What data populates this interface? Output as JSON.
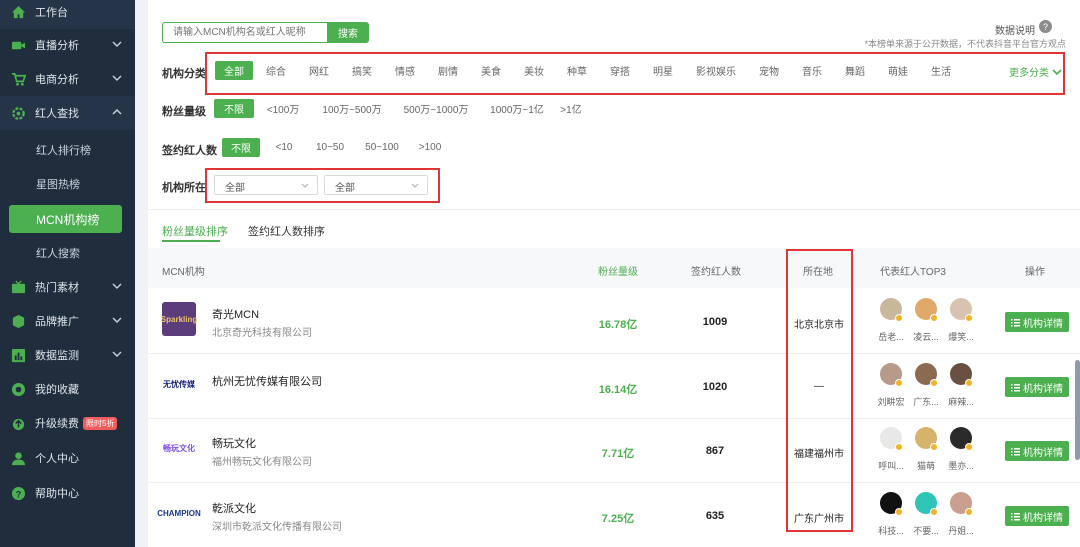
{
  "sidebar": {
    "items": [
      {
        "label": "工作台",
        "icon": "home-icon"
      },
      {
        "label": "直播分析",
        "icon": "video-icon"
      },
      {
        "label": "电商分析",
        "icon": "cart-icon"
      },
      {
        "label": "红人查找",
        "icon": "gear-icon"
      },
      {
        "label": "热门素材",
        "icon": "tv-icon"
      },
      {
        "label": "品牌推广",
        "icon": "cube-icon"
      },
      {
        "label": "数据监测",
        "icon": "bar-chart-icon"
      },
      {
        "label": "我的收藏",
        "icon": "star-icon"
      },
      {
        "label": "升级续费",
        "icon": "upgrade-icon",
        "badge": "限时5折"
      },
      {
        "label": "个人中心",
        "icon": "user-icon"
      },
      {
        "label": "帮助中心",
        "icon": "help-icon"
      }
    ],
    "sub_items": [
      "红人排行榜",
      "星图热榜",
      "MCN机构榜",
      "红人搜索"
    ]
  },
  "search": {
    "placeholder": "请输入MCN机构名或红人昵称",
    "button": "搜索"
  },
  "data_note": "数据说明",
  "disclaimer": "*本榜单来源于公开数据，不代表抖音平台官方观点",
  "filters": {
    "category_label": "机构分类",
    "categories": [
      "全部",
      "综合",
      "网红",
      "搞笑",
      "情感",
      "剧情",
      "美食",
      "美妆",
      "种草",
      "穿搭",
      "明星",
      "影视娱乐",
      "宠物",
      "音乐",
      "舞蹈",
      "萌娃",
      "生活"
    ],
    "more": "更多分类",
    "fans_label": "粉丝量级",
    "fans_options": [
      "不限",
      "<100万",
      "100万~500万",
      "500万~1000万",
      "1000万~1亿",
      ">1亿"
    ],
    "signed_label": "签约红人数",
    "signed_options": [
      "不限",
      "<10",
      "10~50",
      "50~100",
      ">100"
    ],
    "location_label": "机构所在",
    "location_selects": [
      "全部",
      "全部"
    ]
  },
  "tabs": [
    "粉丝量级排序",
    "签约红人数排序"
  ],
  "table": {
    "headers": [
      "MCN机构",
      "粉丝量级",
      "签约红人数",
      "所在地",
      "代表红人TOP3",
      "操作"
    ],
    "action_label": "机构详情",
    "rows": [
      {
        "name": "奇光MCN",
        "sub": "北京奇光科技有限公司",
        "logo": "Sparkling",
        "fans": "16.78亿",
        "signed": "1009",
        "location": "北京北京市",
        "top3": [
          "岳老...",
          "凌云...",
          "爆笑..."
        ]
      },
      {
        "name": "杭州无忧传媒有限公司",
        "sub": "",
        "logo": "无忧传媒",
        "fans": "16.14亿",
        "signed": "1020",
        "location": "—",
        "top3": [
          "刘畊宏",
          "广东...",
          "麻辣..."
        ]
      },
      {
        "name": "畅玩文化",
        "sub": "福州畅玩文化有限公司",
        "logo": "畅玩文化",
        "fans": "7.71亿",
        "signed": "867",
        "location": "福建福州市",
        "top3": [
          "呼叫...",
          "猫萌",
          "墨亦..."
        ]
      },
      {
        "name": "乾派文化",
        "sub": "深圳市乾派文化传播有限公司",
        "logo": "CHAMPION",
        "fans": "7.25亿",
        "signed": "635",
        "location": "广东广州市",
        "top3": [
          "科技...",
          "不要...",
          "丹姐..."
        ]
      }
    ]
  },
  "colors": {
    "accent": "#4caf50",
    "sidebar": "#1f2d3d",
    "highlight": "#e03535"
  }
}
